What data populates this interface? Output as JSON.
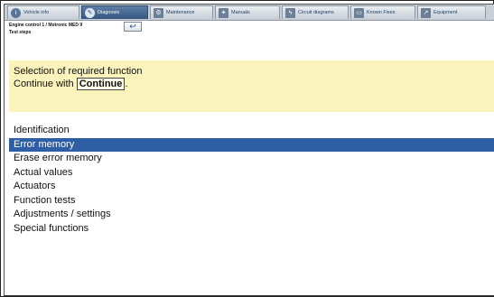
{
  "tabs": [
    {
      "label": "Vehicle info",
      "icon": "info-icon"
    },
    {
      "label": "Diagnosis",
      "icon": "stethoscope-icon",
      "active": true
    },
    {
      "label": "Maintenance",
      "icon": "gears-icon"
    },
    {
      "label": "Manuals",
      "icon": "wrench-icon"
    },
    {
      "label": "Circuit diagrams",
      "icon": "lightning-icon"
    },
    {
      "label": "Known Fixes",
      "icon": "monitor-icon"
    },
    {
      "label": "Equipment",
      "icon": "external-link-icon"
    }
  ],
  "context": {
    "line1": "Engine control 1 / Motronic MED 9",
    "line2": "Test steps"
  },
  "message": {
    "line1": "Selection of required function",
    "line2_prefix": "Continue with",
    "button_label": "Continue",
    "line2_suffix": "."
  },
  "functions": [
    {
      "label": "Identification",
      "selected": false
    },
    {
      "label": "Error memory",
      "selected": true
    },
    {
      "label": "Erase error memory",
      "selected": false
    },
    {
      "label": "Actual values",
      "selected": false
    },
    {
      "label": "Actuators",
      "selected": false
    },
    {
      "label": "Function tests",
      "selected": false
    },
    {
      "label": "Adjustments / settings",
      "selected": false
    },
    {
      "label": "Special functions",
      "selected": false
    }
  ],
  "colors": {
    "selection": "#2e5ea4",
    "message_bg": "#fbf3bc",
    "active_tab": "#34557f"
  }
}
